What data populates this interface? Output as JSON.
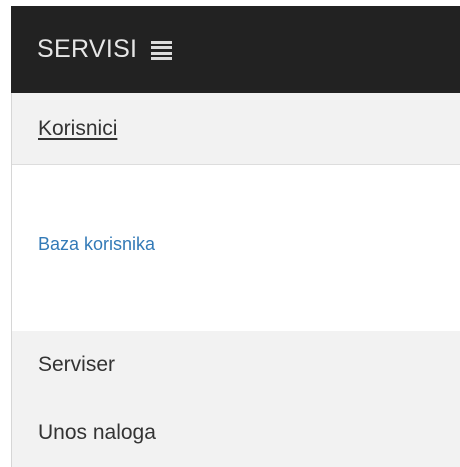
{
  "navbar": {
    "brand": "SERVISI",
    "menu_icon": "hamburger-menu-icon"
  },
  "panel": {
    "header_link": "Korisnici",
    "body_link": "Baza korisnika"
  },
  "nav_items": [
    {
      "label": "Serviser"
    },
    {
      "label": "Unos naloga"
    }
  ],
  "colors": {
    "navbar_bg": "#222222",
    "navbar_text": "#e6e6e6",
    "panel_bg": "#f2f2f2",
    "link_blue": "#337ab7",
    "text_dark": "#333333"
  }
}
